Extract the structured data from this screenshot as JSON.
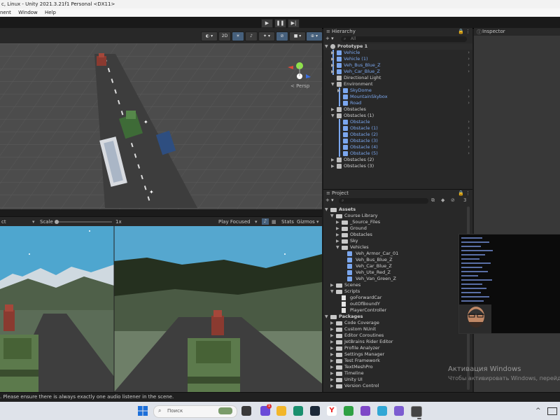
{
  "window": {
    "title": "c, Linux - Unity 2021.3.21f1 Personal <DX11>"
  },
  "menu": {
    "items": [
      "nent",
      "Window",
      "Help"
    ]
  },
  "scene_toolbar": {
    "btn_2d": "2D",
    "persp": "< Persp"
  },
  "game_toolbar": {
    "display_partial": "ct",
    "scale_label": "Scale",
    "scale_value": "1x",
    "play_mode": "Play Focused",
    "stats": "Stats",
    "gizmos": "Gizmos"
  },
  "hierarchy": {
    "tab": "Hierarchy",
    "search_placeholder": "All",
    "items": [
      {
        "label": "Prototype 1",
        "color": "white",
        "depth": 0,
        "arrow": "▼",
        "chevron": false,
        "icon": "unity-scene-icon"
      },
      {
        "label": "Vehicle",
        "color": "blue",
        "depth": 1,
        "arrow": "▶",
        "chevron": true,
        "icon": "prefab-icon"
      },
      {
        "label": "Vehicle (1)",
        "color": "blue",
        "depth": 1,
        "arrow": "▶",
        "chevron": true,
        "icon": "prefab-icon"
      },
      {
        "label": "Veh_Bus_Blue_Z",
        "color": "blue",
        "depth": 1,
        "arrow": "▶",
        "chevron": true,
        "icon": "prefab-icon"
      },
      {
        "label": "Veh_Car_Blue_Z",
        "color": "blue",
        "depth": 1,
        "arrow": "▶",
        "chevron": true,
        "icon": "prefab-icon"
      },
      {
        "label": "Directional Light",
        "color": "white",
        "depth": 1,
        "arrow": "",
        "chevron": false,
        "icon": "gameobject-icon"
      },
      {
        "label": "Environment",
        "color": "white",
        "depth": 1,
        "arrow": "▼",
        "chevron": false,
        "icon": "gameobject-icon"
      },
      {
        "label": "SkyDome",
        "color": "blue",
        "depth": 2,
        "arrow": "▶",
        "chevron": true,
        "icon": "prefab-icon"
      },
      {
        "label": "MountainSkybox",
        "color": "blue",
        "depth": 2,
        "arrow": "",
        "chevron": true,
        "icon": "prefab-icon"
      },
      {
        "label": "Road",
        "color": "blue",
        "depth": 2,
        "arrow": "",
        "chevron": true,
        "icon": "prefab-icon"
      },
      {
        "label": "Obstacles",
        "color": "white",
        "depth": 1,
        "arrow": "▶",
        "chevron": false,
        "icon": "gameobject-icon"
      },
      {
        "label": "Obstacles (1)",
        "color": "white",
        "depth": 1,
        "arrow": "▼",
        "chevron": false,
        "icon": "gameobject-icon"
      },
      {
        "label": "Obstacle",
        "color": "blue",
        "depth": 2,
        "arrow": "",
        "chevron": true,
        "icon": "prefab-icon"
      },
      {
        "label": "Obstacle (1)",
        "color": "blue",
        "depth": 2,
        "arrow": "",
        "chevron": true,
        "icon": "prefab-icon"
      },
      {
        "label": "Obstacle (2)",
        "color": "blue",
        "depth": 2,
        "arrow": "",
        "chevron": true,
        "icon": "prefab-icon"
      },
      {
        "label": "Obstacle (3)",
        "color": "blue",
        "depth": 2,
        "arrow": "",
        "chevron": true,
        "icon": "prefab-icon"
      },
      {
        "label": "Obstacle (4)",
        "color": "blue",
        "depth": 2,
        "arrow": "",
        "chevron": true,
        "icon": "prefab-icon"
      },
      {
        "label": "Obstacle (5)",
        "color": "blue",
        "depth": 2,
        "arrow": "",
        "chevron": true,
        "icon": "prefab-icon"
      },
      {
        "label": "Obstacles (2)",
        "color": "white",
        "depth": 1,
        "arrow": "▶",
        "chevron": false,
        "icon": "gameobject-icon"
      },
      {
        "label": "Obstacles (3)",
        "color": "white",
        "depth": 1,
        "arrow": "▶",
        "chevron": false,
        "icon": "gameobject-icon"
      }
    ]
  },
  "project": {
    "tab": "Project",
    "count_badge": "3",
    "items": [
      {
        "label": "Assets",
        "depth": 0,
        "arrow": "▼",
        "kind": "folder",
        "bold": true
      },
      {
        "label": "Course Library",
        "depth": 1,
        "arrow": "▼",
        "kind": "folder"
      },
      {
        "label": "_Source_Files",
        "depth": 2,
        "arrow": "▶",
        "kind": "folder"
      },
      {
        "label": "Ground",
        "depth": 2,
        "arrow": "▶",
        "kind": "folder"
      },
      {
        "label": "Obstacles",
        "depth": 2,
        "arrow": "▶",
        "kind": "folder"
      },
      {
        "label": "Sky",
        "depth": 2,
        "arrow": "▶",
        "kind": "folder"
      },
      {
        "label": "Vehicles",
        "depth": 2,
        "arrow": "▼",
        "kind": "folder"
      },
      {
        "label": "Veh_Armor_Car_01",
        "depth": 3,
        "arrow": "",
        "kind": "prefab"
      },
      {
        "label": "Veh_Bus_Blue_Z",
        "depth": 3,
        "arrow": "",
        "kind": "prefab"
      },
      {
        "label": "Veh_Car_Blue_Z",
        "depth": 3,
        "arrow": "",
        "kind": "prefab"
      },
      {
        "label": "Veh_Ute_Red_Z",
        "depth": 3,
        "arrow": "",
        "kind": "prefab"
      },
      {
        "label": "Veh_Van_Green_Z",
        "depth": 3,
        "arrow": "",
        "kind": "prefab"
      },
      {
        "label": "Scenes",
        "depth": 1,
        "arrow": "▶",
        "kind": "folder"
      },
      {
        "label": "Scripts",
        "depth": 1,
        "arrow": "▼",
        "kind": "folder"
      },
      {
        "label": "goForwardCar",
        "depth": 2,
        "arrow": "",
        "kind": "script"
      },
      {
        "label": "outOfBoundY",
        "depth": 2,
        "arrow": "",
        "kind": "script"
      },
      {
        "label": "PlayerController",
        "depth": 2,
        "arrow": "",
        "kind": "script"
      },
      {
        "label": "Packages",
        "depth": 0,
        "arrow": "▼",
        "kind": "folder",
        "bold": true
      },
      {
        "label": "Code Coverage",
        "depth": 1,
        "arrow": "▶",
        "kind": "folder"
      },
      {
        "label": "Custom NUnit",
        "depth": 1,
        "arrow": "▶",
        "kind": "folder"
      },
      {
        "label": "Editor Coroutines",
        "depth": 1,
        "arrow": "▶",
        "kind": "folder"
      },
      {
        "label": "JetBrains Rider Editor",
        "depth": 1,
        "arrow": "▶",
        "kind": "folder"
      },
      {
        "label": "Profile Analyzer",
        "depth": 1,
        "arrow": "▶",
        "kind": "folder"
      },
      {
        "label": "Settings Manager",
        "depth": 1,
        "arrow": "▶",
        "kind": "folder"
      },
      {
        "label": "Test Framework",
        "depth": 1,
        "arrow": "▶",
        "kind": "folder"
      },
      {
        "label": "TextMeshPro",
        "depth": 1,
        "arrow": "▶",
        "kind": "folder"
      },
      {
        "label": "Timeline",
        "depth": 1,
        "arrow": "▶",
        "kind": "folder"
      },
      {
        "label": "Unity UI",
        "depth": 1,
        "arrow": "▶",
        "kind": "folder"
      },
      {
        "label": "Version Control",
        "depth": 1,
        "arrow": "▶",
        "kind": "folder"
      }
    ]
  },
  "inspector": {
    "tab": "Inspector"
  },
  "console": {
    "message": ". Please ensure there is always exactly one audio listener in the scene."
  },
  "watermark": {
    "line1": "Активация Windows",
    "line2": "Чтобы активировать Windows, перейдите"
  },
  "taskbar": {
    "search_placeholder": "Поиск",
    "badge_count": "1"
  },
  "colors": {
    "accent_blue": "#7ba7ef",
    "selection": "#2c5d87",
    "panel": "#282828",
    "road": "#3d3d3d"
  }
}
